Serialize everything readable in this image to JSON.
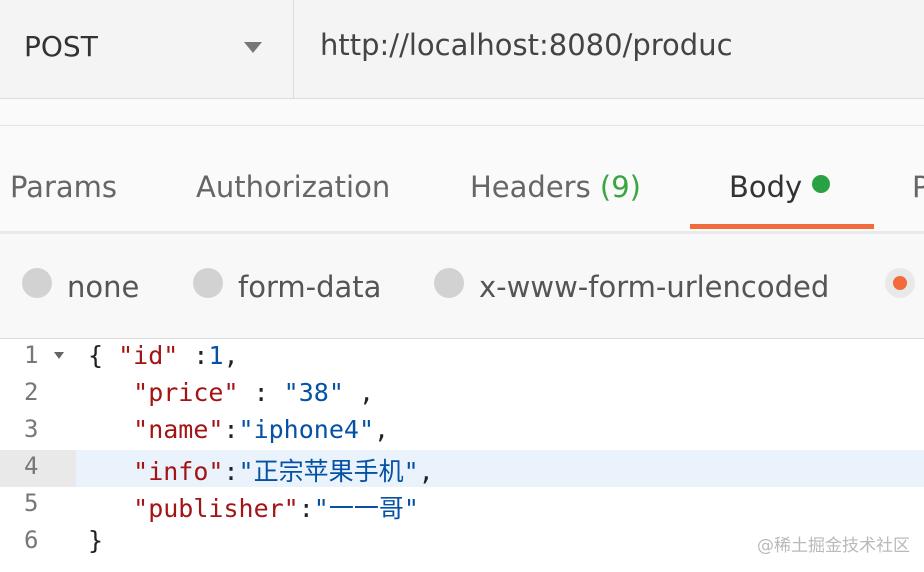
{
  "request": {
    "method": "POST",
    "url": "http://localhost:8080/produc"
  },
  "tabs": [
    {
      "label": "Params"
    },
    {
      "label": "Authorization"
    },
    {
      "label": "Headers",
      "count": "(9)"
    },
    {
      "label": "Body",
      "active": true
    },
    {
      "label": "P"
    }
  ],
  "body_options": [
    {
      "label": "none",
      "selected": false
    },
    {
      "label": "form-data",
      "selected": false
    },
    {
      "label": "x-www-form-urlencoded",
      "selected": false
    },
    {
      "label": "",
      "selected": true
    }
  ],
  "editor": {
    "highlighted_line": 4,
    "lines": [
      {
        "n": "1",
        "indent": "",
        "key": "\"id\"",
        "sep": " :",
        "value": "1",
        "value_type": "number",
        "trail": ",",
        "open": "{ "
      },
      {
        "n": "2",
        "indent": "   ",
        "key": "\"price\"",
        "sep": " : ",
        "value": "\"38\"",
        "value_type": "string",
        "trail": " ,"
      },
      {
        "n": "3",
        "indent": "   ",
        "key": "\"name\"",
        "sep": ":",
        "value": "\"iphone4\"",
        "value_type": "string",
        "trail": ","
      },
      {
        "n": "4",
        "indent": "   ",
        "key": "\"info\"",
        "sep": ":",
        "value": "\"正宗苹果手机\"",
        "value_type": "string",
        "trail": ","
      },
      {
        "n": "5",
        "indent": "   ",
        "key": "\"publisher\"",
        "sep": ":",
        "value": "\"一一哥\"",
        "value_type": "string",
        "trail": ""
      },
      {
        "n": "6",
        "indent": "",
        "close": "}"
      }
    ]
  },
  "watermark": "@稀土掘金技术社区",
  "colors": {
    "accent": "#f26b3a",
    "active_dot": "#29a244",
    "json_key": "#a31515",
    "json_value": "#0451a5"
  }
}
